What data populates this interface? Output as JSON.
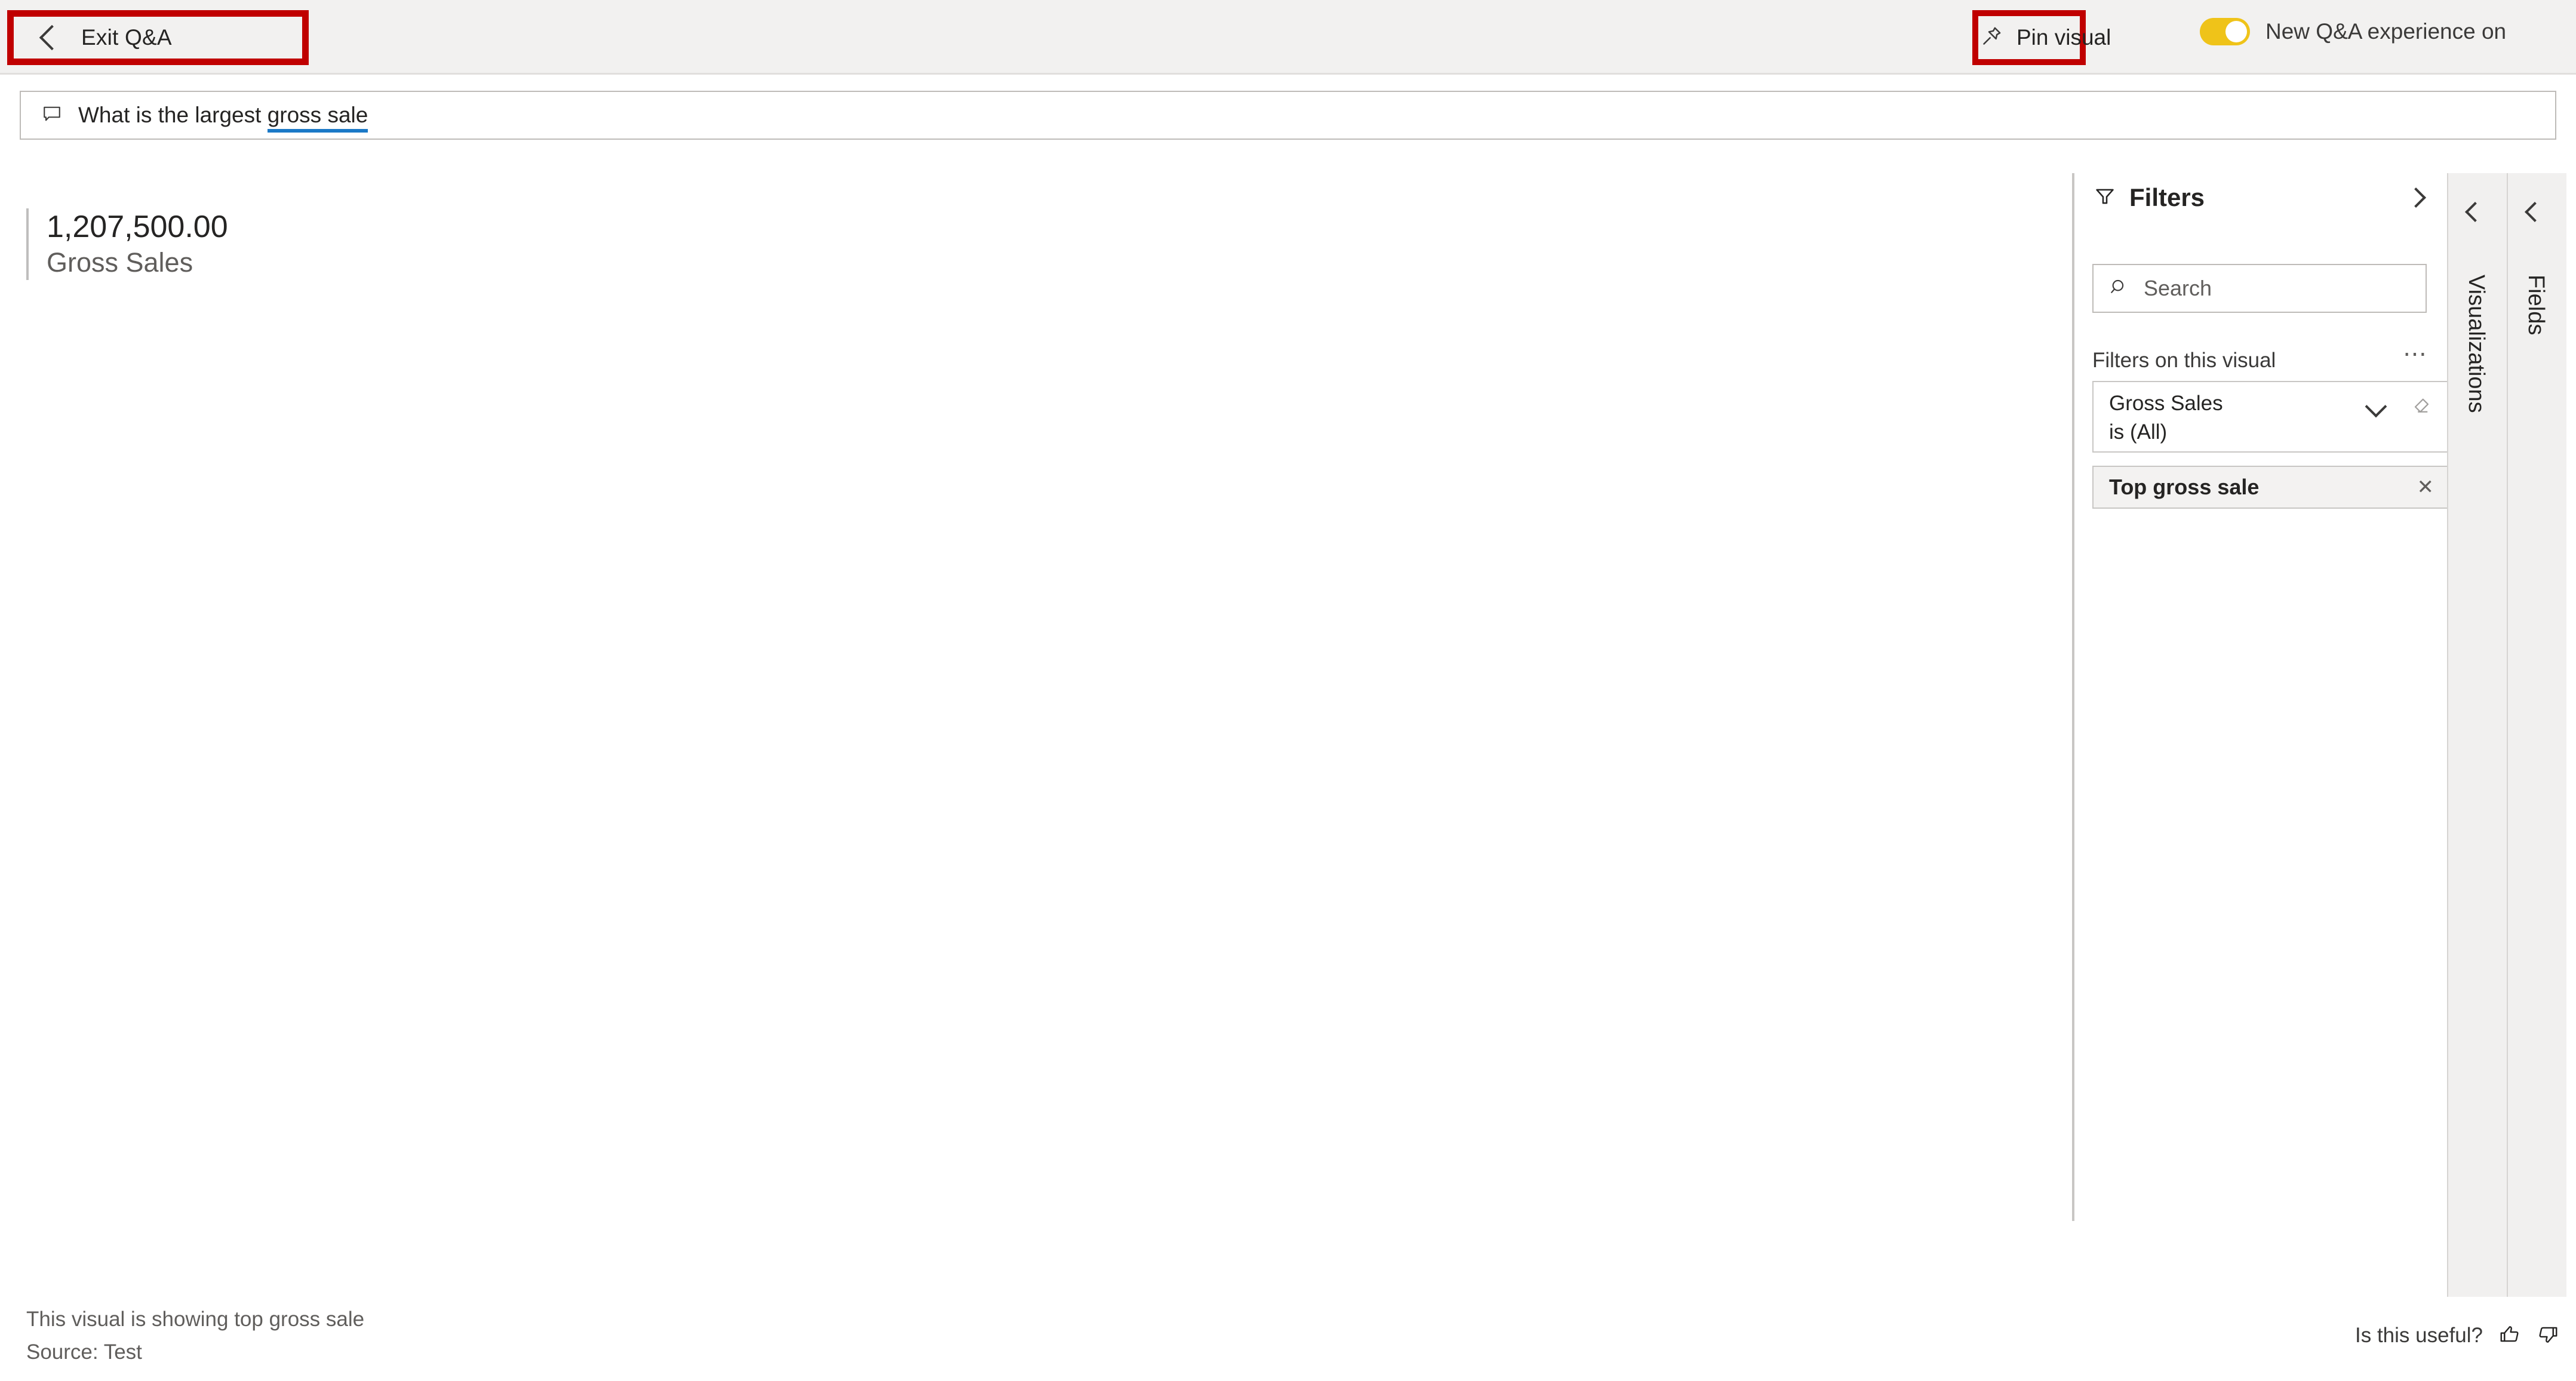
{
  "header": {
    "exit_button": {
      "label": "Exit Q&A",
      "icon": "chevron-left-icon"
    },
    "pin_button": {
      "label": "Pin visual",
      "icon": "pin-icon"
    },
    "toggle": {
      "label": "New Q&A experience on",
      "state": "on",
      "on_color": "#EFC319"
    },
    "annotation_color": "#C00000"
  },
  "question_bar": {
    "icon": "speech-bubble-icon",
    "text_prefix": "What is the largest ",
    "recognized_term": "gross sale",
    "underline_color": "#1B79C7"
  },
  "visual": {
    "value": "1,207,500.00",
    "label": "Gross Sales"
  },
  "filters": {
    "title": "Filters",
    "icon": "filter-funnel-icon",
    "expand_icon": "chevron-right-icon",
    "search": {
      "placeholder": "Search",
      "icon": "search-icon"
    },
    "section_label": "Filters on this visual",
    "more_menu": "⋯",
    "cards": [
      {
        "field": "Gross Sales",
        "condition": "is (All)",
        "expand_icon": "chevron-down-icon",
        "clear_icon": "eraser-icon"
      }
    ],
    "chips": [
      {
        "label": "Top gross sale",
        "remove_icon": "close-icon"
      }
    ]
  },
  "side_panels": [
    {
      "label": "Visualizations",
      "expand_icon": "chevron-left-icon"
    },
    {
      "label": "Fields",
      "expand_icon": "chevron-left-icon"
    }
  ],
  "footer": {
    "line1": "This visual is showing top gross sale",
    "line2": "Source: Test",
    "feedback_label": "Is this useful?",
    "thumbs_up_icon": "thumbs-up-icon",
    "thumbs_down_icon": "thumbs-down-icon"
  }
}
